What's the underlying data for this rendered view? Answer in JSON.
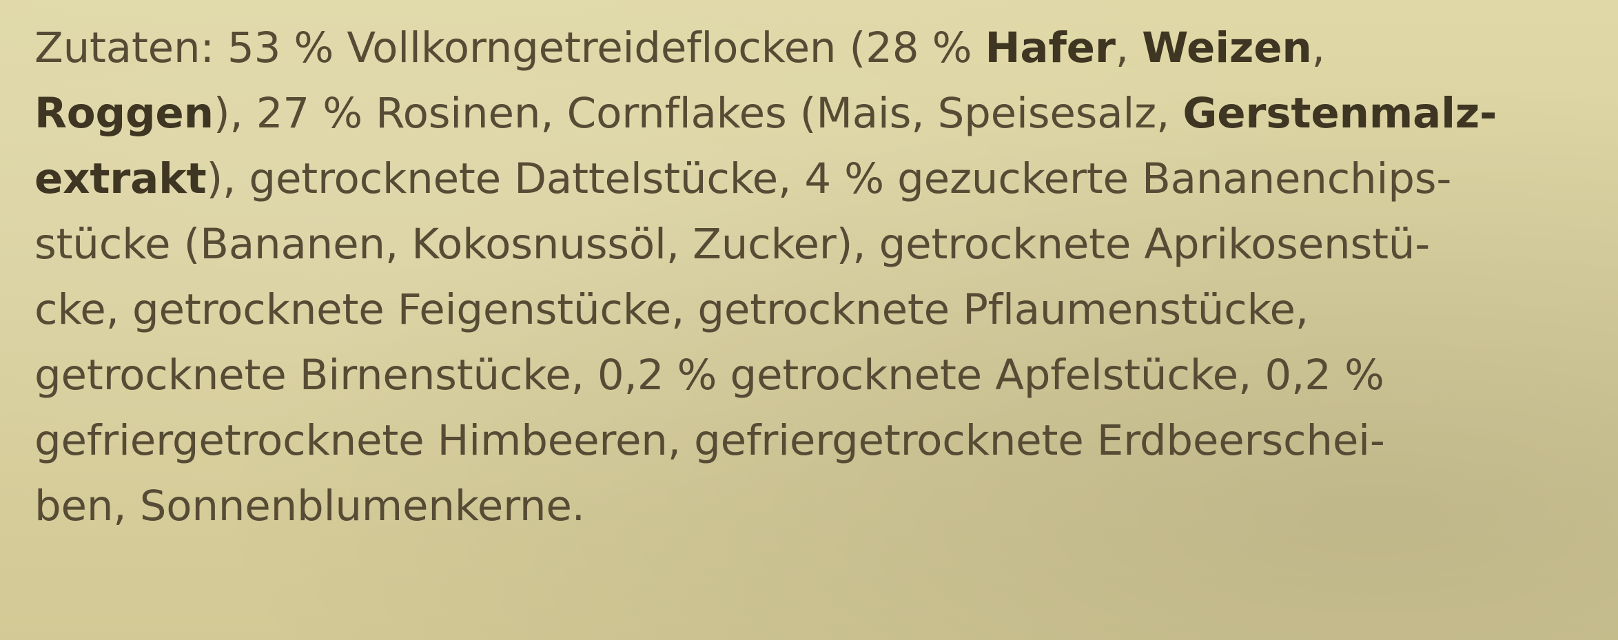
{
  "label": {
    "lines": [
      [
        {
          "text": "Zutaten: 53 % Vollkorngetreideflocken (28 % ",
          "bold": false
        },
        {
          "text": "Hafer",
          "bold": true
        },
        {
          "text": ", ",
          "bold": false
        },
        {
          "text": "Weizen",
          "bold": true
        },
        {
          "text": ",",
          "bold": false
        }
      ],
      [
        {
          "text": "Roggen",
          "bold": true
        },
        {
          "text": "), 27 % Rosinen, Cornflakes (Mais, Speisesalz, ",
          "bold": false
        },
        {
          "text": "Gerstenmalz-",
          "bold": true
        }
      ],
      [
        {
          "text": "extrakt",
          "bold": true
        },
        {
          "text": "), getrocknete Dattelstücke, 4 % gezuckerte Bananenchips-",
          "bold": false
        }
      ],
      [
        {
          "text": "stücke (Bananen, Kokosnussöl, Zucker), getrocknete Aprikosenstü-",
          "bold": false
        }
      ],
      [
        {
          "text": "cke, getrocknete Feigenstücke, getrocknete Pflaumenstücke,",
          "bold": false
        }
      ],
      [
        {
          "text": "getrocknete Birnenstücke, 0,2 % getrocknete Apfelstücke, 0,2 %",
          "bold": false
        }
      ],
      [
        {
          "text": "gefriergetrocknete Himbeeren, gefriergetrocknete Erdbeerschei-",
          "bold": false
        }
      ],
      [
        {
          "text": "ben, Sonnenblumenkerne.",
          "bold": false
        }
      ]
    ]
  },
  "colors": {
    "paper": "#dcd3a1",
    "ink": "#564c35",
    "ink_bold": "#3e3522"
  }
}
